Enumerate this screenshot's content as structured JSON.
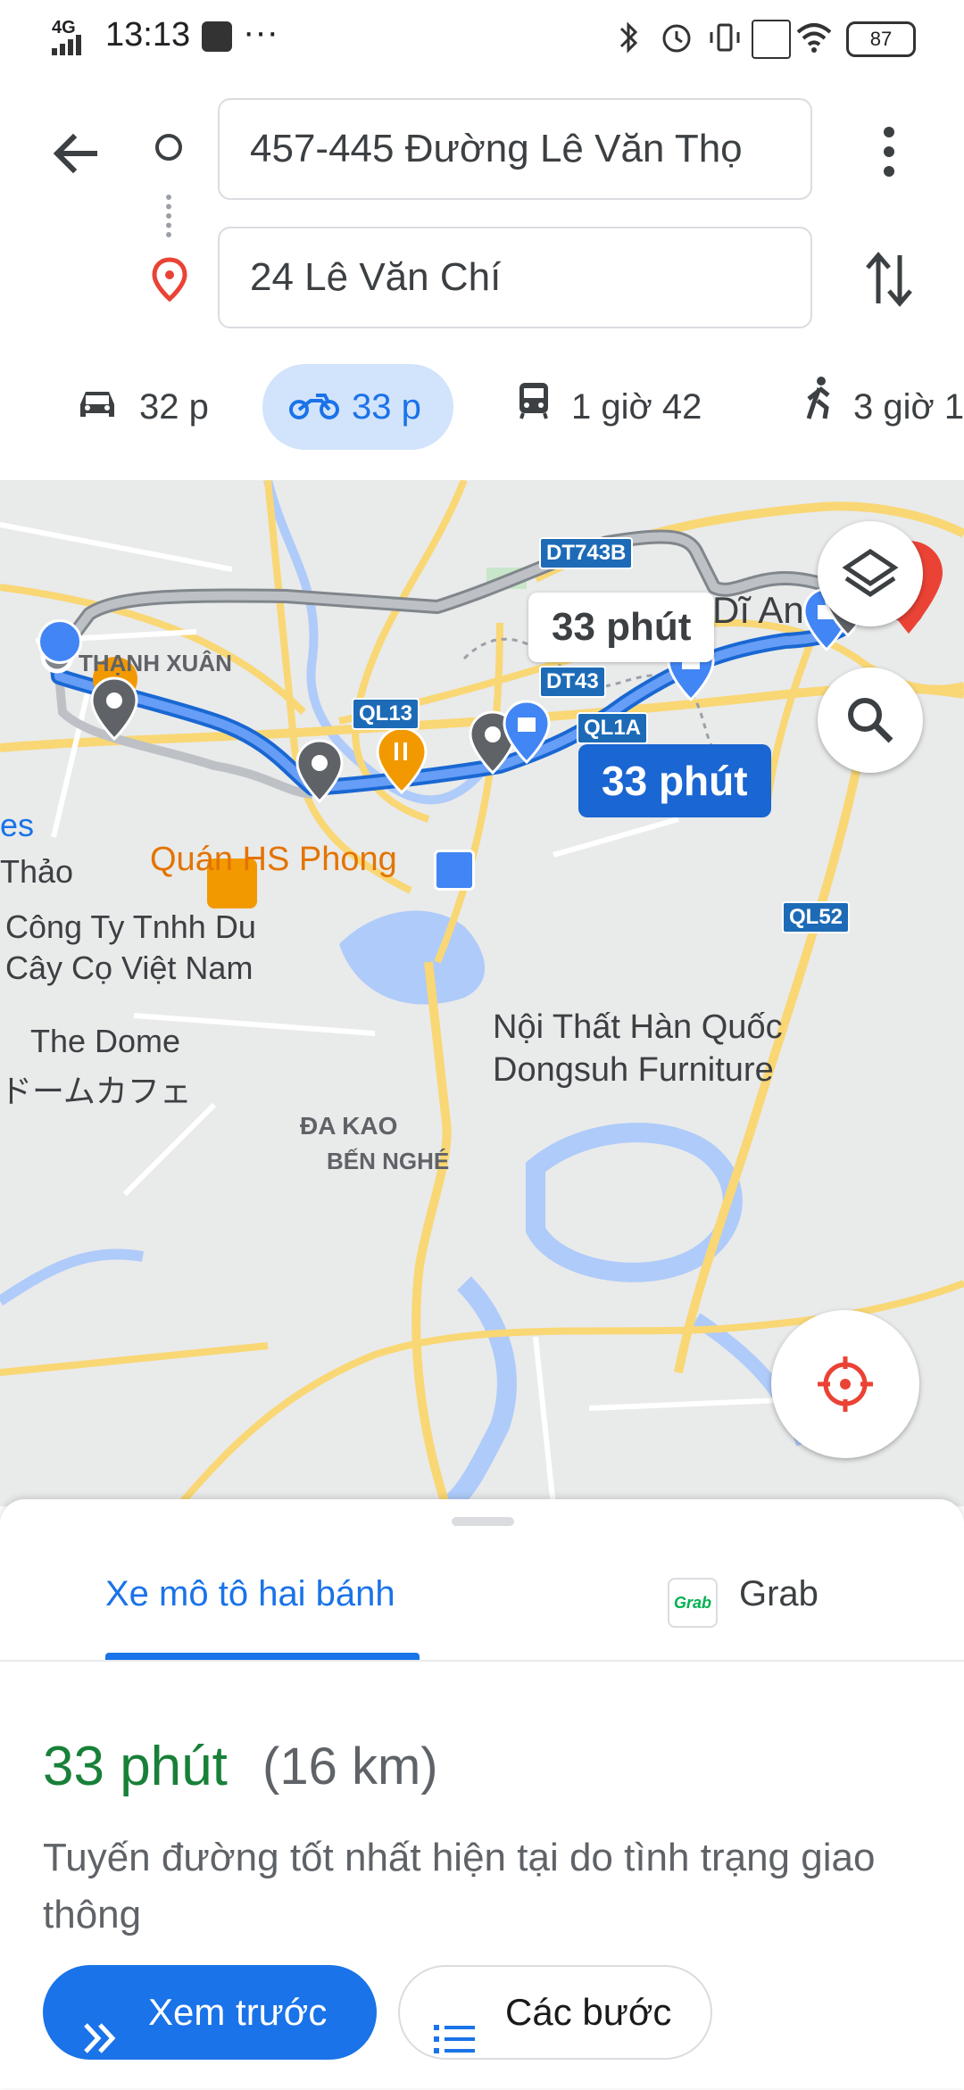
{
  "status_bar": {
    "network": "4G",
    "time": "13:13",
    "extra": "···",
    "battery": "87"
  },
  "search": {
    "origin": "457-445 Đường Lê Văn Thọ",
    "destination": "24 Lê Văn Chí"
  },
  "modes": [
    {
      "icon": "car-icon",
      "label": "32 p"
    },
    {
      "icon": "motorbike-icon",
      "label": "33 p"
    },
    {
      "icon": "transit-icon",
      "label": "1 giờ 42"
    },
    {
      "icon": "walk-icon",
      "label": "3 giờ 1"
    }
  ],
  "map": {
    "labels": {
      "thanh_xuan": "THẠNH XUÂN",
      "di_an": "Tx. Dĩ An",
      "quan_hs": "Quán HS Phong",
      "thao": "Thảo",
      "es": "es",
      "cong_ty_1": "Công Ty Tnhh Du",
      "cong_ty_2": "Cây Cọ Việt Nam",
      "dome_1": "The Dome",
      "dome_2": "ドームカフェ",
      "noi_that_1": "Nội Thất Hàn Quốc",
      "noi_that_2": "Dongsuh Furniture",
      "da_kao": "ĐA KAO",
      "ben_nghe": "BẾN NGHÉ"
    },
    "shields": {
      "dt743b": "DT743B",
      "dt43": "DT43",
      "ql13": "QL13",
      "ql1a": "QL1A",
      "ql52": "QL52"
    },
    "alt_route_time": "33 phút",
    "route_time": "33 phút"
  },
  "sheet": {
    "tab_motorbike": "Xe mô tô hai bánh",
    "grab_icon_text": "Grab",
    "tab_grab": "Grab",
    "duration": "33 phút",
    "distance": "(16 km)",
    "description": "Tuyến đường tốt nhất hiện tại do tình trạng giao thông",
    "preview_button": "Xem trước",
    "steps_button": "Các bước"
  },
  "colors": {
    "accent": "#1a73e8",
    "route": "#4285f4",
    "alt_route": "#9aa0a6",
    "duration_green": "#188038",
    "destination_pin": "#ea4335"
  }
}
